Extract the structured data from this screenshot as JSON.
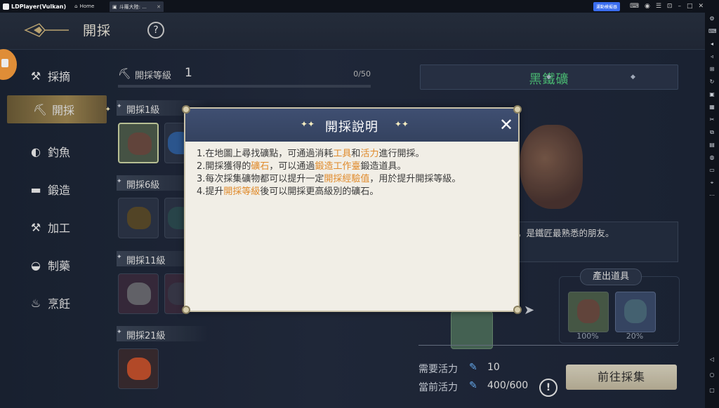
{
  "titlebar": {
    "app_name": "LDPlayer(Vulkan)",
    "home_label": "Home",
    "tab_label": "斗羅大陸: ...",
    "sync_label": "運動模擬器"
  },
  "header": {
    "title": "開採"
  },
  "sidebar": {
    "items": [
      {
        "label": "採摘",
        "icon": "pick-icon"
      },
      {
        "label": "開採",
        "icon": "mining-icon"
      },
      {
        "label": "釣魚",
        "icon": "fishing-icon"
      },
      {
        "label": "鍛造",
        "icon": "anvil-icon"
      },
      {
        "label": "加工",
        "icon": "hammer-icon"
      },
      {
        "label": "制藥",
        "icon": "mortar-icon"
      },
      {
        "label": "烹飪",
        "icon": "cooking-icon"
      }
    ],
    "active": "開採"
  },
  "level": {
    "label": "開採等級",
    "value": "1",
    "progress_text": "0/50",
    "progress": 0.0
  },
  "groups": [
    {
      "label": "開採1級"
    },
    {
      "label": "開採6級"
    },
    {
      "label": "開採11級"
    },
    {
      "label": "開採21級"
    }
  ],
  "detail": {
    "name": "黑鐵礦",
    "description": "，是鐵匠最熟悉的朋友。",
    "outputs_title": "產出道具",
    "outputs": [
      {
        "percent": "100%"
      },
      {
        "percent": "20%"
      }
    ],
    "need_energy_label": "需要活力",
    "need_energy_value": "10",
    "current_energy_label": "當前活力",
    "current_energy_value": "400/600",
    "go_button": "前往採集"
  },
  "modal": {
    "title": "開採說明",
    "lines": [
      [
        {
          "t": "1.在地圖上尋找礦點，可通過消耗"
        },
        {
          "t": "工具",
          "h": true
        },
        {
          "t": "和"
        },
        {
          "t": "活力",
          "h": true
        },
        {
          "t": "進行開採。"
        }
      ],
      [
        {
          "t": "2.開採獲得的"
        },
        {
          "t": "礦石",
          "h": true
        },
        {
          "t": "，可以通過"
        },
        {
          "t": "鍛造工作臺",
          "h": true
        },
        {
          "t": "鍛造道具。"
        }
      ],
      [
        {
          "t": "3.每次採集礦物都可以提升一定"
        },
        {
          "t": "開採經驗值",
          "h": true
        },
        {
          "t": "，用於提升開採等級。"
        }
      ],
      [
        {
          "t": "4.提升"
        },
        {
          "t": "開採等級",
          "h": true
        },
        {
          "t": "後可以開採更高級別的礦石。"
        }
      ]
    ]
  },
  "colors": {
    "highlight": "#e08a2a",
    "ore_name": "#4fc57a",
    "accent_gold": "#c3a868"
  }
}
